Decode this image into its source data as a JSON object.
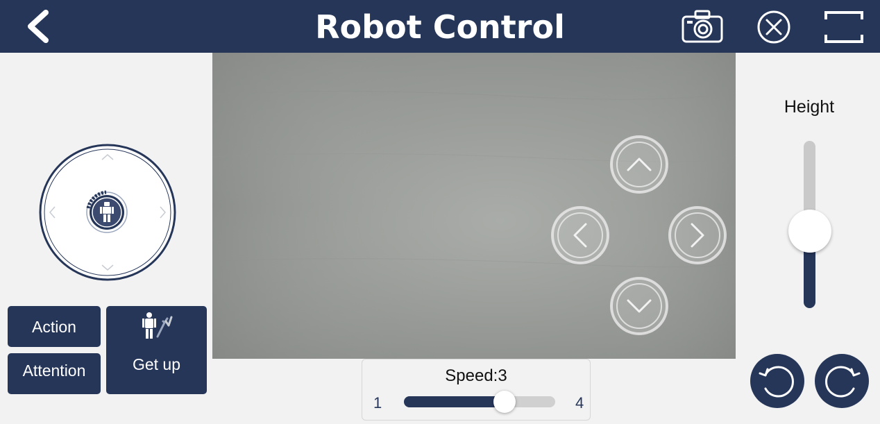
{
  "header": {
    "title": "Robot Control",
    "icons": {
      "back": "chevron-left-icon",
      "camera": "camera-icon",
      "close": "close-circle-icon",
      "fullscreen": "fullscreen-icon"
    }
  },
  "buttons": {
    "action": "Action",
    "attention": "Attention",
    "get_up": "Get up"
  },
  "speed": {
    "label": "Speed:3",
    "min": "1",
    "max": "4",
    "value": 3
  },
  "height": {
    "label": "Height",
    "level": 0.46
  },
  "direction_pad": [
    "up",
    "left",
    "right",
    "down"
  ],
  "colors": {
    "primary": "#263659",
    "background": "#f2f2f2",
    "track": "#d0d0d0"
  }
}
